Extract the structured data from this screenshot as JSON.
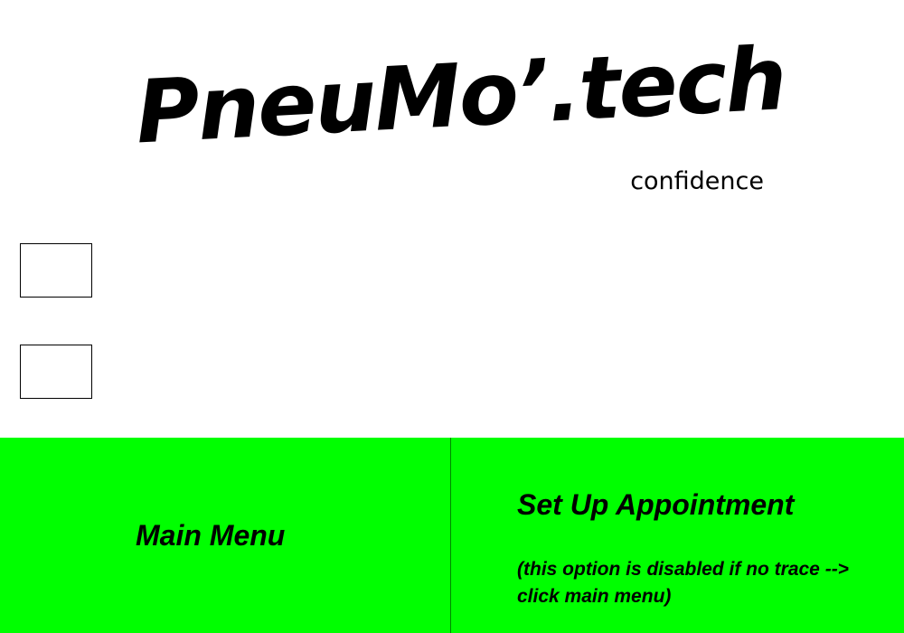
{
  "header": {
    "logo_text": "PneuMo’.tech",
    "tagline": "confidence"
  },
  "options": {
    "checkbox_1_checked": false,
    "checkbox_2_checked": false
  },
  "bottom_bar": {
    "main_menu_label": "Main Menu",
    "appointment_label": "Set Up Appointment",
    "appointment_note_line1": "(this option is disabled if no trace -->",
    "appointment_note_line2": "click main menu)"
  },
  "colors": {
    "bar_background": "#00ff00",
    "text": "#000000",
    "page_background": "#ffffff"
  }
}
